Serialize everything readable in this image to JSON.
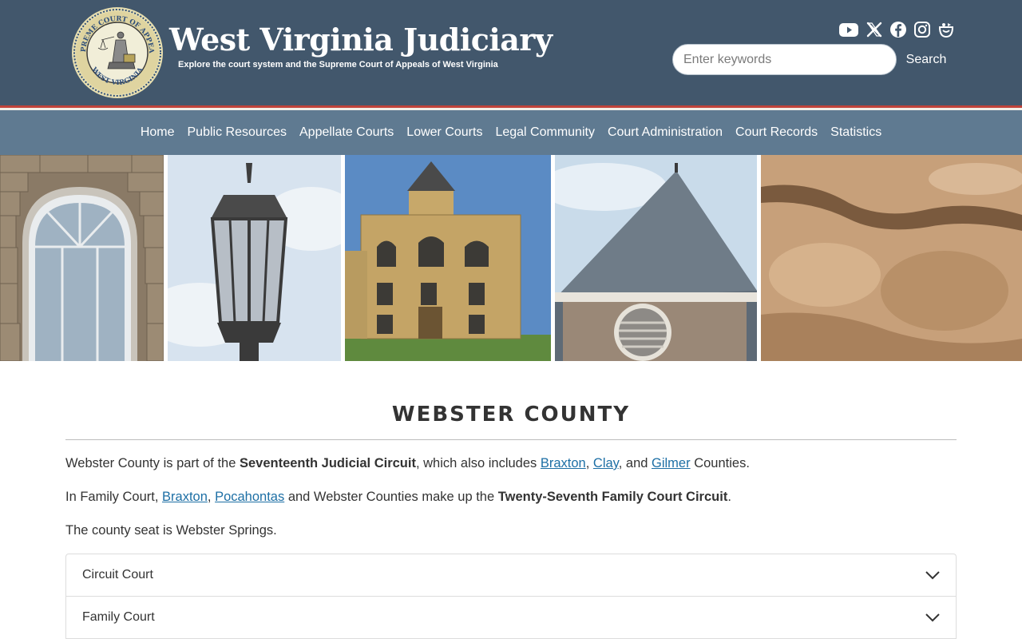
{
  "header": {
    "site_title": "West Virginia Judiciary",
    "tagline": "Explore the court system and the Supreme Court of Appeals of West Virginia",
    "seal": {
      "top_text": "SUPREME COURT OF APPEALS",
      "bottom_text": "WEST VIRGINIA"
    },
    "social_icons": [
      "youtube-icon",
      "x-icon",
      "facebook-icon",
      "instagram-icon",
      "smugmug-icon"
    ],
    "search": {
      "placeholder": "Enter keywords",
      "value": "",
      "button_label": "Search"
    }
  },
  "nav": {
    "items": [
      {
        "label": "Home"
      },
      {
        "label": "Public Resources"
      },
      {
        "label": "Appellate Courts"
      },
      {
        "label": "Lower Courts"
      },
      {
        "label": "Legal Community"
      },
      {
        "label": "Court Administration"
      },
      {
        "label": "Court Records"
      },
      {
        "label": "Statistics"
      }
    ]
  },
  "main": {
    "title": "WEBSTER COUNTY",
    "para1": {
      "prefix": "Webster County is part of the ",
      "circuit": "Seventeenth Judicial Circuit",
      "middle": ", which also includes ",
      "link1": "Braxton",
      "sep1": ", ",
      "link2": "Clay",
      "sep2": ", and ",
      "link3": "Gilmer",
      "suffix": " Counties."
    },
    "para2": {
      "prefix": "In Family Court, ",
      "link1": "Braxton",
      "sep1": ", ",
      "link2": "Pocahontas",
      "middle": " and Webster Counties make up the ",
      "circuit": "Twenty-Seventh Family Court Circuit",
      "suffix": "."
    },
    "para3": "The county seat is Webster Springs.",
    "accordion": [
      {
        "label": "Circuit Court"
      },
      {
        "label": "Family Court"
      }
    ]
  },
  "colors": {
    "header_bg": "#42576c",
    "nav_bg": "#5f7a91",
    "accent_red": "#c0433a",
    "link": "#1d6fa5"
  }
}
